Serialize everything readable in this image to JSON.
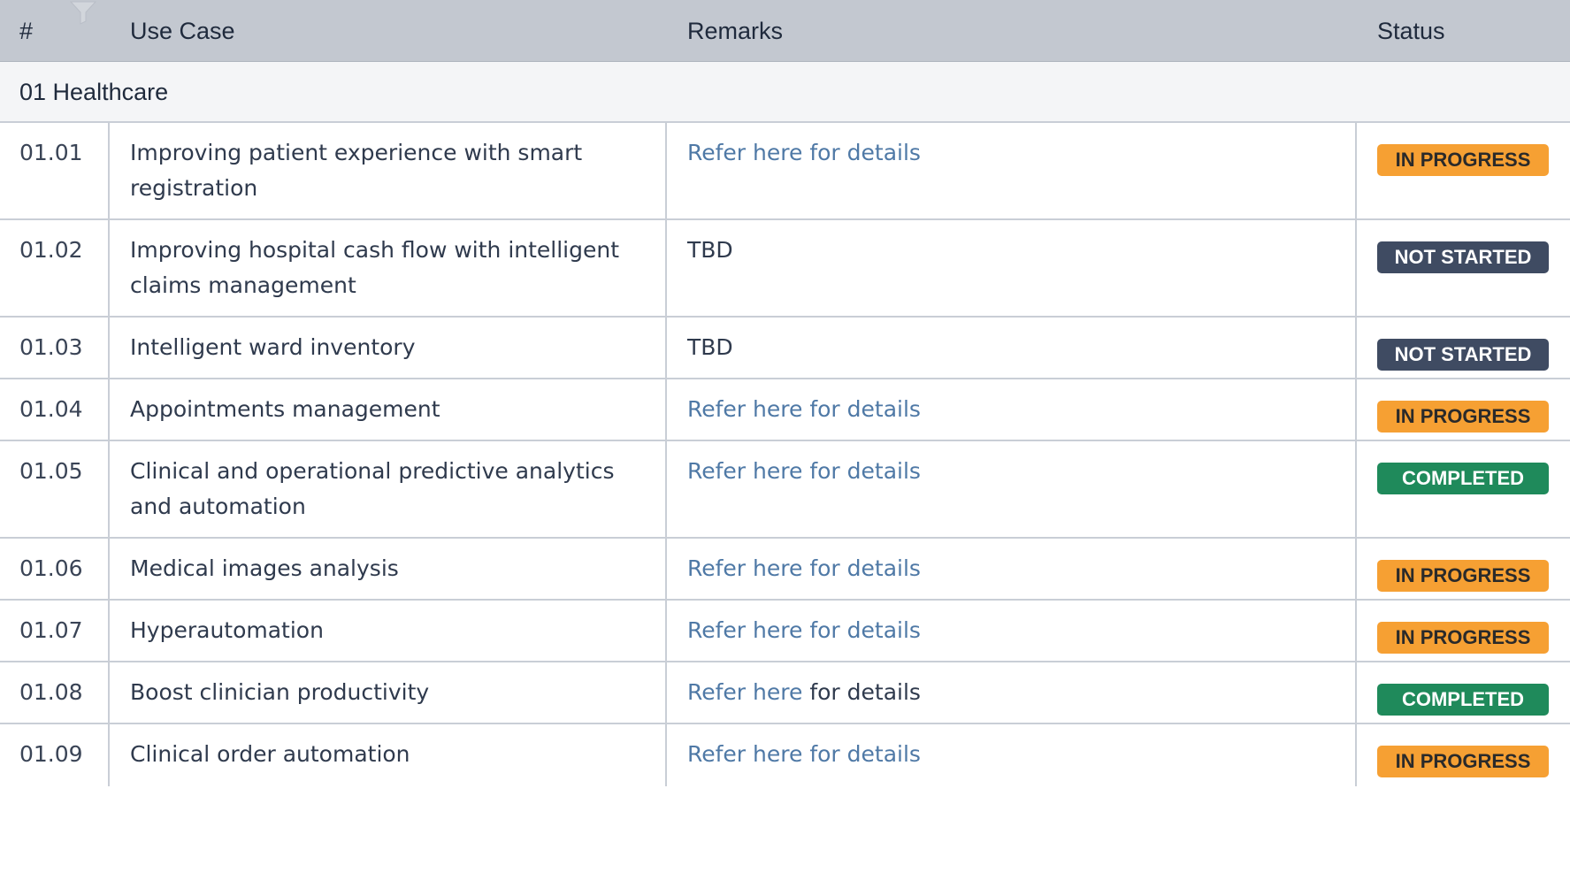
{
  "header": {
    "col_num": "#",
    "col_use_case": "Use Case",
    "col_remarks": "Remarks",
    "col_status": "Status"
  },
  "section": {
    "title": "01 Healthcare"
  },
  "colors": {
    "header_bg": "#c3c8d0",
    "link": "#4f79a6",
    "in_progress": "#f6a033",
    "not_started": "#3f4b62",
    "completed": "#1f8a5b"
  },
  "rows": [
    {
      "num": "01.01",
      "use_case_line1": "Improving patient experience with smart",
      "use_case_line2": "registration",
      "remarks": "Refer here for details",
      "status": "IN PROGRESS"
    },
    {
      "num": "01.02",
      "use_case_line1": "Improving hospital cash flow with intelligent",
      "use_case_line2": "claims management",
      "remarks": "TBD",
      "status": "NOT STARTED"
    },
    {
      "num": "01.03",
      "use_case_line1": "Intelligent ward inventory",
      "remarks": "TBD",
      "status": "NOT STARTED"
    },
    {
      "num": "01.04",
      "use_case_line1": "Appointments management",
      "remarks": "Refer here for details",
      "status": "IN PROGRESS"
    },
    {
      "num": "01.05",
      "use_case_line1": "Clinical and operational predictive analytics",
      "use_case_line2": "and automation",
      "remarks": "Refer here for details",
      "status": "COMPLETED"
    },
    {
      "num": "01.06",
      "use_case_line1": "Medical images analysis",
      "remarks": "Refer here for details",
      "status": "IN PROGRESS"
    },
    {
      "num": "01.07",
      "use_case_line1": "Hyperautomation",
      "remarks": "Refer here for details",
      "status": "IN PROGRESS"
    },
    {
      "num": "01.08",
      "use_case_line1": "Boost clinician productivity",
      "remarks_link": "Refer here",
      "remarks_rest": "for details",
      "status": "COMPLETED"
    },
    {
      "num": "01.09",
      "use_case_line1": "Clinical order automation",
      "remarks": "Refer here for details",
      "status": "IN PROGRESS"
    }
  ]
}
